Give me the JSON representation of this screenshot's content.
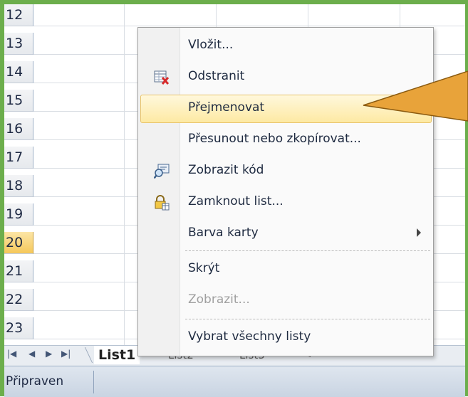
{
  "sheet": {
    "row_numbers": [
      "12",
      "13",
      "14",
      "15",
      "16",
      "17",
      "18",
      "19",
      "20",
      "21",
      "22",
      "23"
    ],
    "active_row": "20"
  },
  "context_menu": {
    "items": [
      {
        "label": "Vložit...",
        "icon": "none"
      },
      {
        "label": "Odstranit",
        "icon": "delete-sheet-icon"
      },
      {
        "label": "Přejmenovat",
        "icon": "none",
        "highlighted": true
      },
      {
        "label": "Přesunout nebo zkopírovat...",
        "icon": "none"
      },
      {
        "label": "Zobrazit kód",
        "icon": "view-code-icon"
      },
      {
        "label": "Zamknout list...",
        "icon": "protect-sheet-icon"
      },
      {
        "label": "Barva karty",
        "icon": "none",
        "submenu": true
      },
      {
        "label": "Skrýt",
        "icon": "none"
      },
      {
        "label": "Zobrazit...",
        "icon": "none",
        "disabled": true
      },
      {
        "label": "Vybrat všechny listy",
        "icon": "none"
      }
    ]
  },
  "tabs": {
    "nav_icons": [
      "first-sheet-icon",
      "prev-sheet-icon",
      "next-sheet-icon",
      "last-sheet-icon"
    ],
    "items": [
      "List1",
      "List2",
      "List3"
    ],
    "active": "List1",
    "new_sheet_icon": "insert-sheet-icon"
  },
  "status": {
    "text": "Připraven"
  },
  "colors": {
    "frame": "#6cae4c",
    "highlight": "#fde9a3",
    "callout": "#e8a33a"
  }
}
